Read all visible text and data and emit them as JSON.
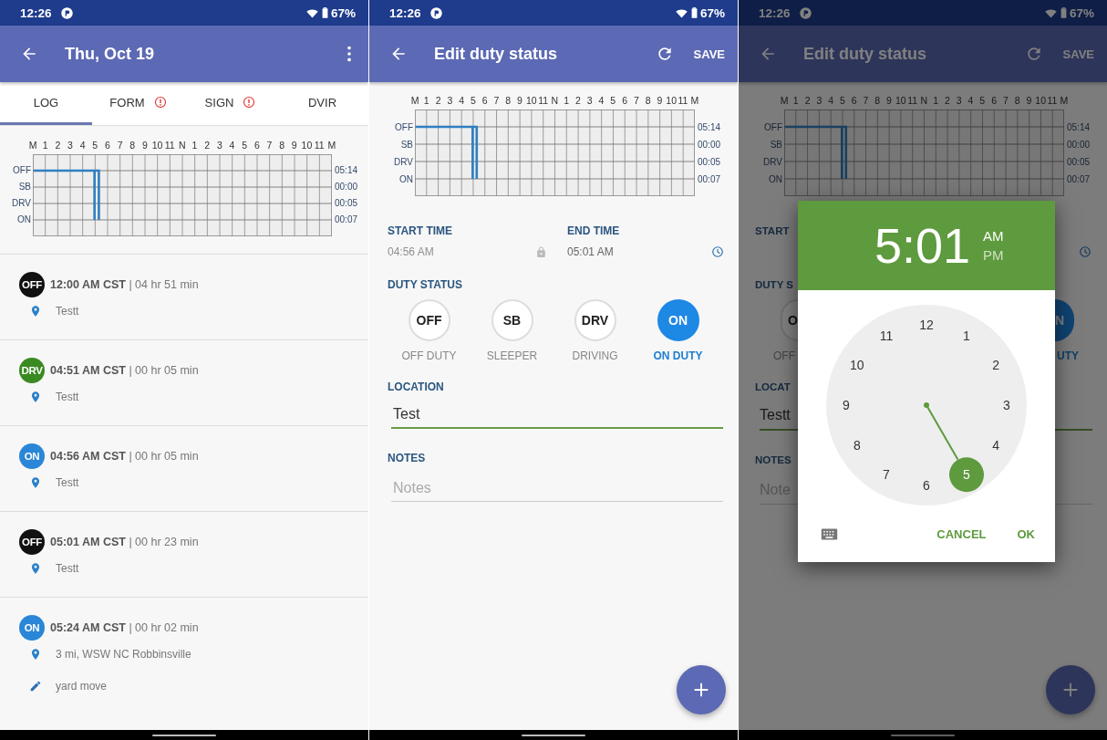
{
  "screens": [
    {
      "status_bar": {
        "time": "12:26",
        "battery": "67%"
      },
      "app_bar": {
        "title": "Thu, Oct 19"
      },
      "tabs": [
        {
          "label": "LOG",
          "selected": true,
          "alert": false
        },
        {
          "label": "FORM",
          "selected": false,
          "alert": true
        },
        {
          "label": "SIGN",
          "selected": false,
          "alert": true
        },
        {
          "label": "DVIR",
          "selected": false,
          "alert": false
        }
      ],
      "graph": {
        "hour_labels": [
          "M",
          "1",
          "2",
          "3",
          "4",
          "5",
          "6",
          "7",
          "8",
          "9",
          "10",
          "11",
          "N",
          "1",
          "2",
          "3",
          "4",
          "5",
          "6",
          "7",
          "8",
          "9",
          "10",
          "11",
          "M"
        ],
        "rows": [
          {
            "label": "OFF",
            "total": "05:14"
          },
          {
            "label": "SB",
            "total": "00:00"
          },
          {
            "label": "DRV",
            "total": "00:05"
          },
          {
            "label": "ON",
            "total": "00:07"
          }
        ]
      },
      "log_entries": [
        {
          "badge": "OFF",
          "color": "#111111",
          "summary": "**12:00 AM CST** | 04 hr 51 min",
          "lines": [
            {
              "kind": "location",
              "text": "Testt"
            }
          ]
        },
        {
          "badge": "DRV",
          "color": "#3a8a22",
          "summary": "**04:51 AM CST** | 00 hr 05 min",
          "lines": [
            {
              "kind": "location",
              "text": "Testt"
            }
          ]
        },
        {
          "badge": "ON",
          "color": "#2a86d6",
          "summary": "**04:56 AM CST** | 00 hr 05 min",
          "lines": [
            {
              "kind": "location",
              "text": "Testt"
            }
          ]
        },
        {
          "badge": "OFF",
          "color": "#111111",
          "summary": "**05:01 AM CST** | 00 hr 23 min",
          "lines": [
            {
              "kind": "location",
              "text": "Testt"
            }
          ]
        },
        {
          "badge": "ON",
          "color": "#2a86d6",
          "summary": "**05:24 AM CST** | 00 hr 02 min",
          "lines": [
            {
              "kind": "location",
              "text": "3 mi, WSW NC Robbinsville"
            },
            {
              "kind": "note",
              "text": "yard move"
            }
          ]
        }
      ]
    },
    {
      "status_bar": {
        "time": "12:26",
        "battery": "67%"
      },
      "app_bar": {
        "title": "Edit duty status",
        "action": "SAVE"
      },
      "graph": {
        "hour_labels": [
          "M",
          "1",
          "2",
          "3",
          "4",
          "5",
          "6",
          "7",
          "8",
          "9",
          "10",
          "11",
          "N",
          "1",
          "2",
          "3",
          "4",
          "5",
          "6",
          "7",
          "8",
          "9",
          "10",
          "11",
          "M"
        ],
        "rows": [
          {
            "label": "OFF",
            "total": "05:14"
          },
          {
            "label": "SB",
            "total": "00:00"
          },
          {
            "label": "DRV",
            "total": "00:05"
          },
          {
            "label": "ON",
            "total": "00:07"
          }
        ]
      },
      "start_time": {
        "label": "START TIME",
        "value": "04:56 AM",
        "disabled": true
      },
      "end_time": {
        "label": "END TIME",
        "value": "05:01 AM"
      },
      "duty_status": {
        "label": "DUTY STATUS",
        "options": [
          {
            "code": "OFF",
            "label": "OFF DUTY",
            "selected": false
          },
          {
            "code": "SB",
            "label": "SLEEPER",
            "selected": false
          },
          {
            "code": "DRV",
            "label": "DRIVING",
            "selected": false
          },
          {
            "code": "ON",
            "label": "ON DUTY",
            "selected": true
          }
        ]
      },
      "location": {
        "label": "LOCATION",
        "value": "Test"
      },
      "notes": {
        "label": "NOTES",
        "placeholder": "Notes"
      }
    },
    {
      "status_bar": {
        "time": "12:26",
        "battery": "67%"
      },
      "app_bar": {
        "title": "Edit duty status",
        "action": "SAVE"
      },
      "graph": {
        "hour_labels": [
          "M",
          "1",
          "2",
          "3",
          "4",
          "5",
          "6",
          "7",
          "8",
          "9",
          "10",
          "11",
          "N",
          "1",
          "2",
          "3",
          "4",
          "5",
          "6",
          "7",
          "8",
          "9",
          "10",
          "11",
          "M"
        ],
        "rows": [
          {
            "label": "OFF",
            "total": "05:14"
          },
          {
            "label": "SB",
            "total": "00:00"
          },
          {
            "label": "DRV",
            "total": "00:05"
          },
          {
            "label": "ON",
            "total": "00:07"
          }
        ]
      },
      "background": {
        "start_label": "START",
        "duty_label": "DUTY S",
        "off_code": "O",
        "off_label": "OFF",
        "on_code": "N",
        "on_label": "UTY",
        "on_selected": true,
        "location_label": "LOCAT",
        "location_value": "Testt",
        "notes_label": "NOTES",
        "notes_placeholder": "Note"
      },
      "time_picker": {
        "time": "5:01",
        "periods": [
          {
            "label": "AM",
            "selected": true
          },
          {
            "label": "PM",
            "selected": false
          }
        ],
        "numbers": [
          {
            "label": "12",
            "selected": false
          },
          {
            "label": "1",
            "selected": false
          },
          {
            "label": "2",
            "selected": false
          },
          {
            "label": "3",
            "selected": false
          },
          {
            "label": "4",
            "selected": false
          },
          {
            "label": "5",
            "selected": true
          },
          {
            "label": "6",
            "selected": false
          },
          {
            "label": "7",
            "selected": false
          },
          {
            "label": "8",
            "selected": false
          },
          {
            "label": "9",
            "selected": false
          },
          {
            "label": "10",
            "selected": false
          },
          {
            "label": "11",
            "selected": false
          }
        ],
        "buttons": [
          "CANCEL",
          "OK"
        ]
      }
    }
  ]
}
